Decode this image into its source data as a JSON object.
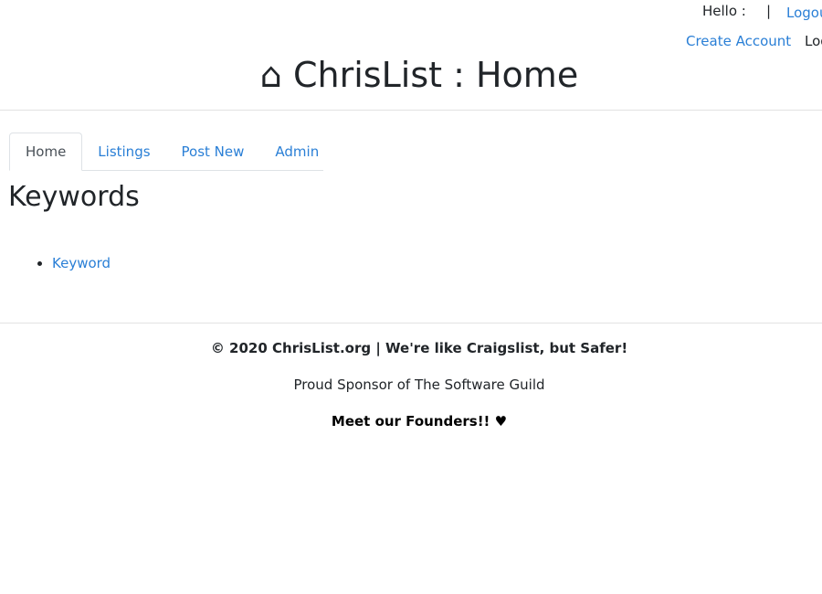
{
  "account": {
    "hello": "Hello :",
    "separator": "|",
    "logout": "Logout",
    "create_account": "Create Account",
    "login": "Login"
  },
  "header": {
    "home_icon": "⌂",
    "title": "ChrisList : Home"
  },
  "tabs": [
    {
      "label": "Home",
      "active": true
    },
    {
      "label": "Listings",
      "active": false
    },
    {
      "label": "Post New",
      "active": false
    },
    {
      "label": "Admin",
      "active": false
    }
  ],
  "main": {
    "heading": "Keywords",
    "keywords": [
      "Keyword"
    ]
  },
  "footer": {
    "copyright": "© 2020 ChrisList.org | We're like Craigslist, but Safer!",
    "sponsor": "Proud Sponsor of The Software Guild",
    "founders": "Meet our Founders!! ♥"
  },
  "colors": {
    "link": "#2a7fd6",
    "text": "#212529"
  }
}
